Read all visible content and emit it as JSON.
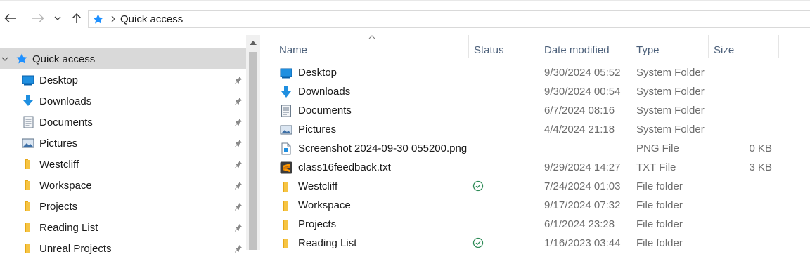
{
  "address": {
    "path": "Quick access"
  },
  "columns": {
    "name": "Name",
    "status": "Status",
    "date": "Date modified",
    "type": "Type",
    "size": "Size"
  },
  "sidebar": {
    "items": [
      {
        "label": "Quick access",
        "icon": "star-icon"
      },
      {
        "label": "Desktop",
        "icon": "desktop-icon"
      },
      {
        "label": "Downloads",
        "icon": "download-arrow-icon"
      },
      {
        "label": "Documents",
        "icon": "document-icon"
      },
      {
        "label": "Pictures",
        "icon": "pictures-icon"
      },
      {
        "label": "Westcliff",
        "icon": "folder-icon"
      },
      {
        "label": "Workspace",
        "icon": "folder-icon"
      },
      {
        "label": "Projects",
        "icon": "folder-icon"
      },
      {
        "label": "Reading List",
        "icon": "folder-icon"
      },
      {
        "label": "Unreal Projects",
        "icon": "folder-icon"
      }
    ]
  },
  "files": [
    {
      "name": "Desktop",
      "status": "",
      "date": "9/30/2024 05:52",
      "type": "System Folder",
      "size": "",
      "icon": "desktop-icon"
    },
    {
      "name": "Downloads",
      "status": "",
      "date": "9/30/2024 00:54",
      "type": "System Folder",
      "size": "",
      "icon": "download-arrow-icon"
    },
    {
      "name": "Documents",
      "status": "",
      "date": "6/7/2024 08:16",
      "type": "System Folder",
      "size": "",
      "icon": "document-icon"
    },
    {
      "name": "Pictures",
      "status": "",
      "date": "4/4/2024 21:18",
      "type": "System Folder",
      "size": "",
      "icon": "pictures-icon"
    },
    {
      "name": "Screenshot 2024-09-30 055200.png",
      "status": "",
      "date": "",
      "type": "PNG File",
      "size": "0 KB",
      "icon": "png-file-icon"
    },
    {
      "name": "class16feedback.txt",
      "status": "",
      "date": "9/29/2024 14:27",
      "type": "TXT File",
      "size": "3 KB",
      "icon": "sublime-text-icon"
    },
    {
      "name": "Westcliff",
      "status": "synced",
      "date": "7/24/2024 01:03",
      "type": "File folder",
      "size": "",
      "icon": "folder-icon"
    },
    {
      "name": "Workspace",
      "status": "",
      "date": "9/17/2024 07:32",
      "type": "File folder",
      "size": "",
      "icon": "folder-icon"
    },
    {
      "name": "Projects",
      "status": "",
      "date": "6/1/2024 23:28",
      "type": "File folder",
      "size": "",
      "icon": "folder-icon"
    },
    {
      "name": "Reading List",
      "status": "synced",
      "date": "1/16/2023 03:44",
      "type": "File folder",
      "size": "",
      "icon": "folder-icon"
    }
  ],
  "colors": {
    "accent": "#0078d4",
    "folder": "#f6c443",
    "sync": "#2e8b57",
    "selected": "#d9d9d9"
  }
}
